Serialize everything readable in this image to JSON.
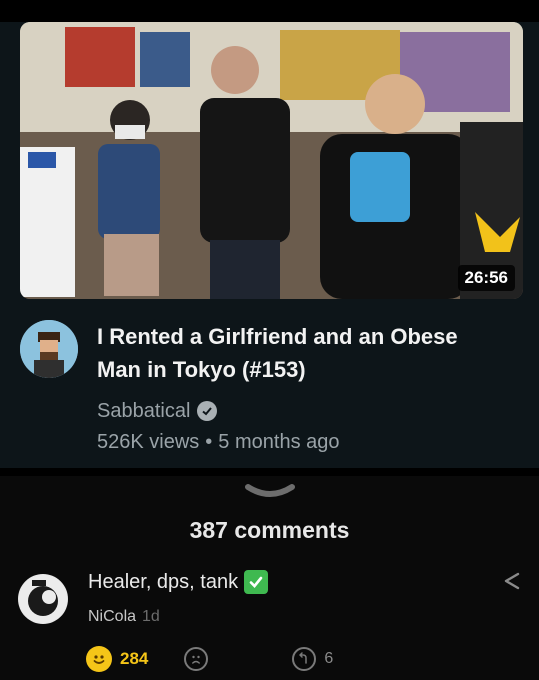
{
  "video": {
    "duration": "26:56",
    "title": "I Rented a Girlfriend and an Obese Man in Tokyo (#153)",
    "channel": "Sabbatical",
    "views": "526K views",
    "age": "5 months ago"
  },
  "comments": {
    "count_label": "387 comments",
    "items": [
      {
        "text": "Healer, dps, tank",
        "author": "NiCola",
        "time": "1d",
        "likes": "284",
        "replies": "6"
      }
    ]
  },
  "colors": {
    "video_card_bg": "#0d1519",
    "like_accent": "#f5c518",
    "check_green": "#3fb950"
  }
}
